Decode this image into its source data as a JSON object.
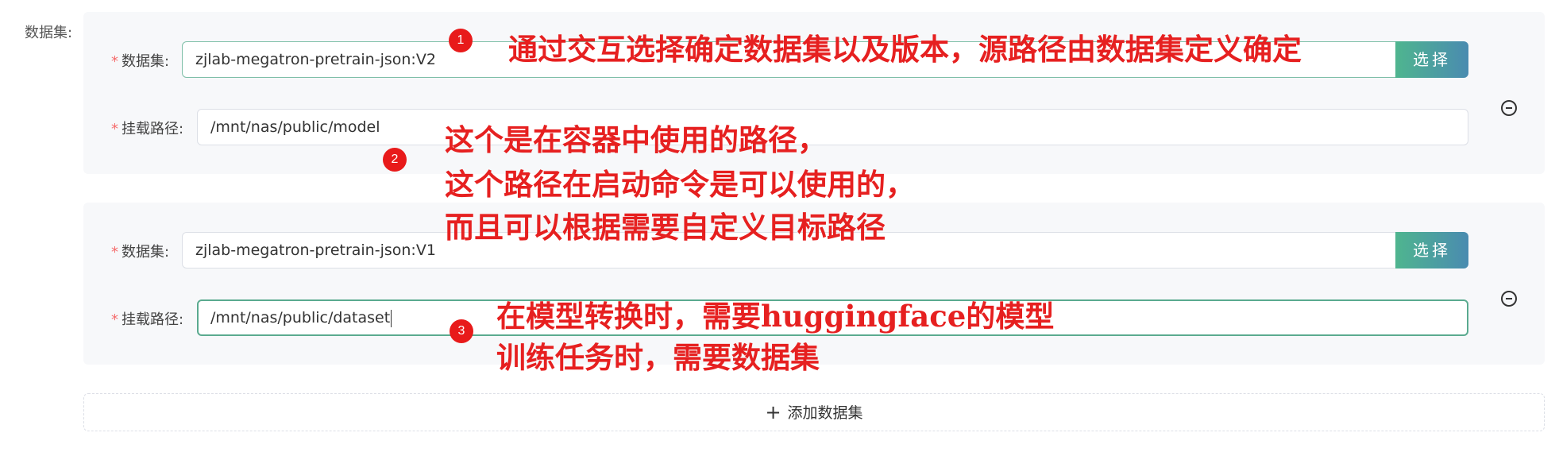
{
  "section_label": "数据集:",
  "datasets": [
    {
      "dataset_label": "数据集:",
      "dataset_value": "zjlab-megatron-pretrain-json:V2",
      "select_label": "选择",
      "mount_label": "挂载路径:",
      "mount_value": "/mnt/nas/public/model"
    },
    {
      "dataset_label": "数据集:",
      "dataset_value": "zjlab-megatron-pretrain-json:V1",
      "select_label": "选择",
      "mount_label": "挂载路径:",
      "mount_value": "/mnt/nas/public/dataset"
    }
  ],
  "required_mark": "*",
  "add_dataset_label": "添加数据集",
  "add_icon": "plus-icon",
  "remove_icon": "minus-circle-icon",
  "annotations": {
    "badge_1": "1",
    "badge_2": "2",
    "badge_3": "3",
    "note_1": "通过交互选择确定数据集以及版本，源路径由数据集定义确定",
    "note_2_line1": "这个是在容器中使用的路径，",
    "note_2_line2": "这个路径在启动命令是可以使用的，",
    "note_2_line3": "而且可以根据需要自定义目标路径",
    "note_3_line1": "在模型转换时，需要huggingface的模型",
    "note_3_line2": "训练任务时，需要数据集"
  },
  "colors": {
    "annotation_red": "#e62020",
    "button_gradient_start": "#4fb58f",
    "button_gradient_end": "#4a8bb0",
    "required_red": "#f56c6c",
    "card_background": "#f7f8fa"
  }
}
